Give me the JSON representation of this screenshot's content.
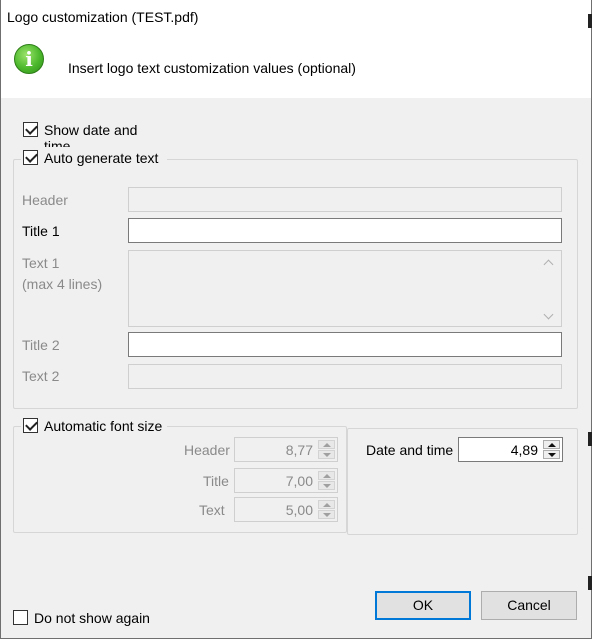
{
  "window": {
    "title": "Logo customization (TEST.pdf)"
  },
  "header": {
    "icon": "info-icon",
    "message": "Insert logo text customization values (optional)"
  },
  "options": {
    "show_date_label_line1": "Show date and",
    "show_date_label_line2": "time",
    "show_date_checked": true,
    "auto_generate_label": "Auto generate text",
    "auto_generate_checked": true
  },
  "fields": {
    "header_label": "Header",
    "header_value": "",
    "title1_label": "Title 1",
    "title1_value": "",
    "text1_label_line1": "Text 1",
    "text1_label_line2": "(max 4 lines)",
    "text1_value": "",
    "title2_label": "Title 2",
    "title2_value": "",
    "text2_label": "Text 2",
    "text2_value": ""
  },
  "font_size": {
    "auto_label": "Automatic font size",
    "auto_checked": true,
    "header_label": "Header",
    "header_value": "8,77",
    "title_label": "Title",
    "title_value": "7,00",
    "text_label": "Text",
    "text_value": "5,00",
    "datetime_label": "Date and time",
    "datetime_value": "4,89"
  },
  "footer": {
    "do_not_show_label": "Do not show again",
    "do_not_show_checked": false,
    "ok_label": "OK",
    "cancel_label": "Cancel"
  },
  "colors": {
    "accent": "#0078d7",
    "info_icon": "#4cb82c"
  }
}
